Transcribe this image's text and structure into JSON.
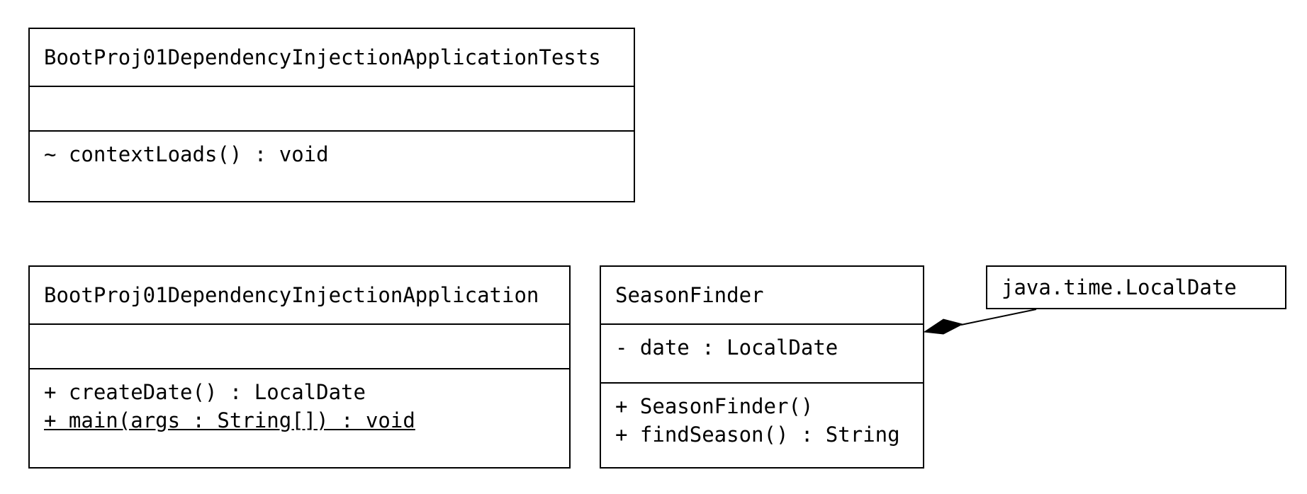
{
  "classes": {
    "tests": {
      "name": "BootProj01DependencyInjectionApplicationTests",
      "attributes": [],
      "operations": [
        {
          "text": "~ contextLoads() : void",
          "static": false
        }
      ]
    },
    "app": {
      "name": "BootProj01DependencyInjectionApplication",
      "attributes": [],
      "operations": [
        {
          "text": "+ createDate() : LocalDate",
          "static": false
        },
        {
          "text": "+ main(args : String[]) : void",
          "static": true
        }
      ]
    },
    "finder": {
      "name": "SeasonFinder",
      "attributes": [
        {
          "text": "- date : LocalDate",
          "static": false
        }
      ],
      "operations": [
        {
          "text": "+ SeasonFinder()",
          "static": false
        },
        {
          "text": "+ findSeason() : String",
          "static": false
        }
      ]
    },
    "localdate": {
      "name": "java.time.LocalDate"
    }
  },
  "relations": [
    {
      "type": "composition",
      "from": "SeasonFinder",
      "to": "java.time.LocalDate"
    }
  ]
}
